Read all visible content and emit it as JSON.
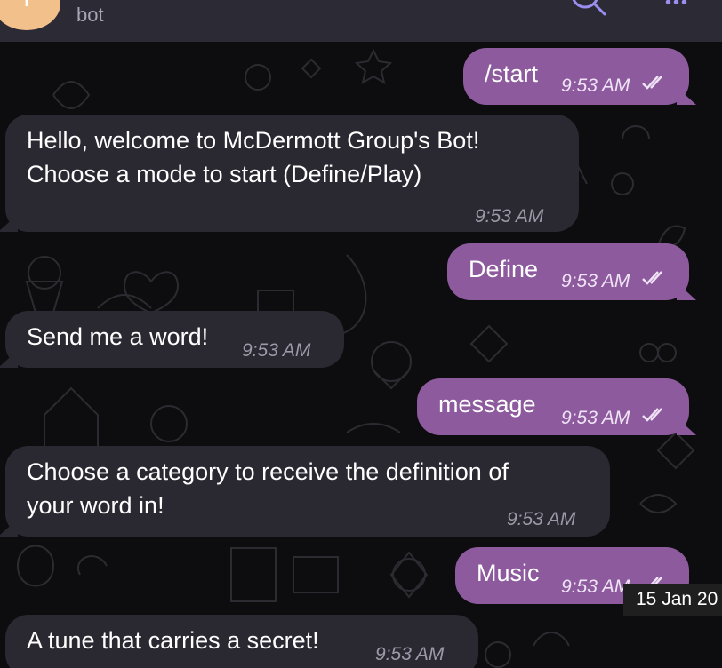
{
  "header": {
    "avatar_letter": "T",
    "subtitle": "bot",
    "search_icon": "search-icon",
    "more_icon": "more-icon"
  },
  "messages": [
    {
      "direction": "out",
      "text": "/start",
      "time": "9:53 AM",
      "status": "read"
    },
    {
      "direction": "in",
      "lines": [
        "Hello, welcome to McDermott Group's Bot!",
        "Choose a mode to start (Define/Play)"
      ],
      "time": "9:53 AM"
    },
    {
      "direction": "out",
      "text": "Define",
      "time": "9:53 AM",
      "status": "read"
    },
    {
      "direction": "in",
      "text": "Send me a word!",
      "time": "9:53 AM"
    },
    {
      "direction": "out",
      "text": "message",
      "time": "9:53 AM",
      "status": "read"
    },
    {
      "direction": "in",
      "lines": [
        "Choose a category to receive the definition of",
        "your word in!"
      ],
      "time": "9:53 AM"
    },
    {
      "direction": "out",
      "text": "Music",
      "time": "9:53 AM",
      "status": "read"
    },
    {
      "direction": "in",
      "text": "A tune that carries a secret!",
      "time": "9:53 AM"
    }
  ],
  "date_badge": "15 Jan 20",
  "colors": {
    "background": "#0d0d0f",
    "header": "#2c2a35",
    "incoming_bubble": "#2a2831",
    "outgoing_bubble": "#8d5a9e",
    "avatar": "#f1c08b"
  }
}
